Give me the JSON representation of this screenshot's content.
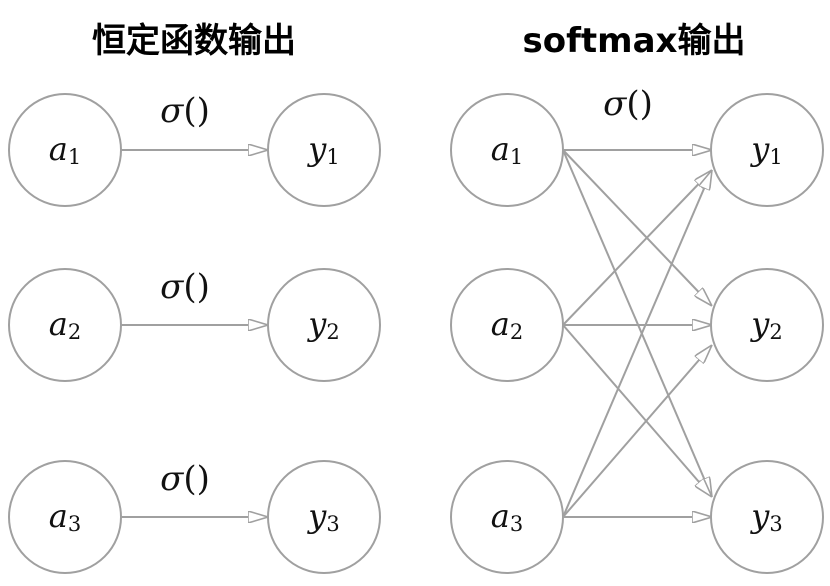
{
  "left": {
    "title": "恒定函数输出",
    "nodes_in": [
      {
        "var": "a",
        "sub": "1"
      },
      {
        "var": "a",
        "sub": "2"
      },
      {
        "var": "a",
        "sub": "3"
      }
    ],
    "nodes_out": [
      {
        "var": "y",
        "sub": "1"
      },
      {
        "var": "y",
        "sub": "2"
      },
      {
        "var": "y",
        "sub": "3"
      }
    ],
    "edge_label": {
      "symbol": "σ",
      "parens": "()"
    }
  },
  "right": {
    "title": "softmax输出",
    "nodes_in": [
      {
        "var": "a",
        "sub": "1"
      },
      {
        "var": "a",
        "sub": "2"
      },
      {
        "var": "a",
        "sub": "3"
      }
    ],
    "nodes_out": [
      {
        "var": "y",
        "sub": "1"
      },
      {
        "var": "y",
        "sub": "2"
      },
      {
        "var": "y",
        "sub": "3"
      }
    ],
    "edge_label": {
      "symbol": "σ",
      "parens": "()"
    }
  },
  "colors": {
    "stroke": "#a0a0a0",
    "text": "#111111",
    "background": "#ffffff"
  }
}
